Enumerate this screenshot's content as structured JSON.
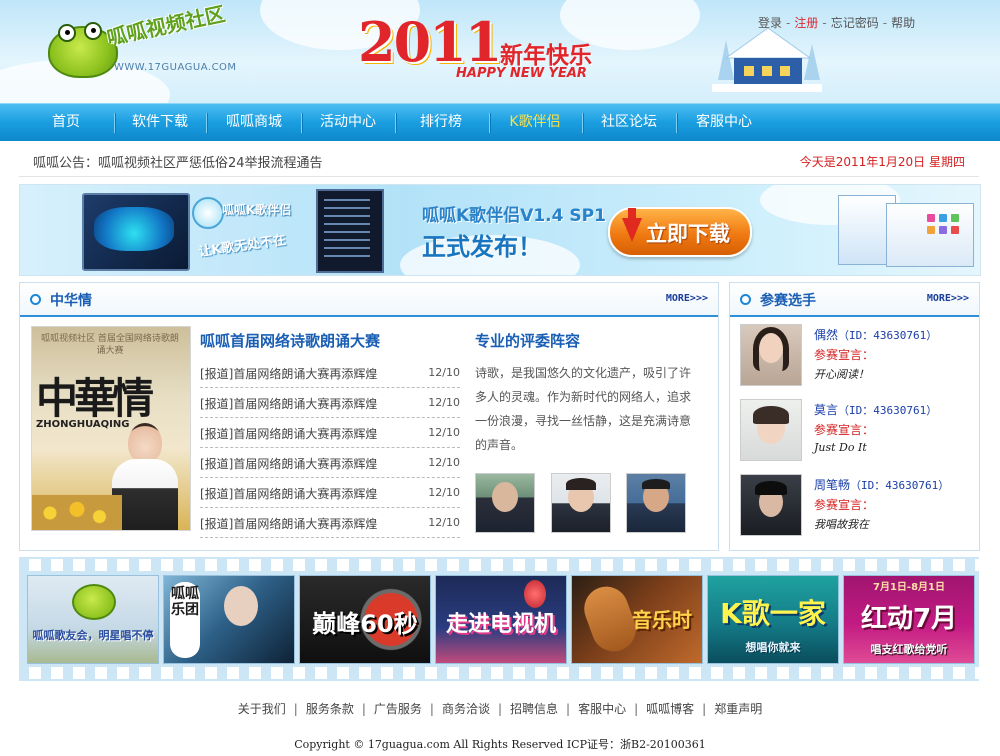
{
  "header": {
    "logo_name": "呱呱视频社区",
    "logo_url": "WWW.17GUAGUA.COM",
    "banner_year": "2011",
    "banner_cn": "新年快乐",
    "banner_en": "HAPPY NEW YEAR",
    "top_links": [
      {
        "label": "登录"
      },
      {
        "label": "注册"
      },
      {
        "label": "忘记密码"
      },
      {
        "label": "帮助"
      }
    ],
    "link_separator": "-"
  },
  "nav": {
    "items": [
      {
        "label": "首页"
      },
      {
        "label": "软件下载"
      },
      {
        "label": "呱呱商城"
      },
      {
        "label": "活动中心"
      },
      {
        "label": "排行榜"
      },
      {
        "label": "K歌伴侣"
      },
      {
        "label": "社区论坛"
      },
      {
        "label": "客服中心"
      }
    ],
    "active_index": 5,
    "active_color": "#f7e14a"
  },
  "notice": {
    "text": "呱呱公告：呱呱视频社区严惩低俗24举报流程通告",
    "date": "今天是2011年1月20日 星期四"
  },
  "kbanner": {
    "app_name": "呱呱K歌伴侣",
    "slogan": "让K歌无处不在",
    "title": "呱呱K歌伴侣V1.4 SP1",
    "subtitle": "正式发布！",
    "download_label": "立即下载"
  },
  "main_panel": {
    "title": "中华情",
    "more_label": "MORE>>>",
    "poster": {
      "top_text": "呱呱视频社区 首届全国网络诗歌朗诵大赛",
      "title": "中華情",
      "pinyin": "ZHONGHUAQING"
    },
    "article_heading": "呱呱首届网络诗歌朗诵大赛",
    "news": [
      {
        "title": "[报道]首届网络朗诵大赛再添辉煌",
        "date": "12/10"
      },
      {
        "title": "[报道]首届网络朗诵大赛再添辉煌",
        "date": "12/10"
      },
      {
        "title": "[报道]首届网络朗诵大赛再添辉煌",
        "date": "12/10"
      },
      {
        "title": "[报道]首届网络朗诵大赛再添辉煌",
        "date": "12/10"
      },
      {
        "title": "[报道]首届网络朗诵大赛再添辉煌",
        "date": "12/10"
      },
      {
        "title": "[报道]首届网络朗诵大赛再添辉煌",
        "date": "12/10"
      }
    ],
    "judges_title": "专业的评委阵容",
    "judges_text": "诗歌，是我国悠久的文化遗产，吸引了许多人的灵魂。作为新时代的网络人，追求一份浪漫，寻找一丝恬静，这是充满诗意的声音。"
  },
  "side_panel": {
    "title": "参赛选手",
    "more_label": "MORE>>>",
    "players": [
      {
        "name": "偶然",
        "id": "（ID：43630761）",
        "label": "参赛宣言：",
        "quote": "开心阅读！"
      },
      {
        "name": "莫言",
        "id": "（ID：43630761）",
        "label": "参赛宣言：",
        "quote": "Just Do It"
      },
      {
        "name": "周笔畅",
        "id": "（ID：43630761）",
        "label": "参赛宣言：",
        "quote": "我唱故我在"
      }
    ]
  },
  "film_strip": {
    "items": [
      {
        "big": "",
        "caption": "呱呱歌友会，明星唱不停"
      },
      {
        "big": "呱呱乐团",
        "caption": ""
      },
      {
        "big": "巅峰60秒",
        "caption": ""
      },
      {
        "big": "走进电视机",
        "caption": ""
      },
      {
        "big": "音乐时",
        "caption": ""
      },
      {
        "big": "K歌一家",
        "caption": "想唱你就来"
      },
      {
        "big": "红动7月",
        "caption": "唱支红歌给党听"
      }
    ],
    "top_text_last": "7月1日-8月1日"
  },
  "footer": {
    "links": [
      {
        "label": "关于我们"
      },
      {
        "label": "服务条款"
      },
      {
        "label": "广告服务"
      },
      {
        "label": "商务洽谈"
      },
      {
        "label": "招聘信息"
      },
      {
        "label": "客服中心"
      },
      {
        "label": "呱呱博客"
      },
      {
        "label": "郑重声明"
      }
    ],
    "separator": "|",
    "copyright": "Copyright © 17guagua.com All Rights Reserved ICP证号：浙B2-20100361"
  }
}
